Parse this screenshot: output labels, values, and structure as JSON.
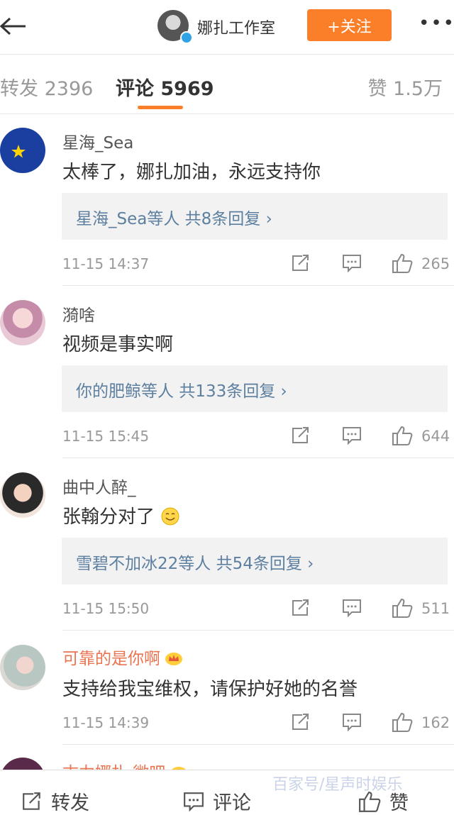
{
  "header": {
    "title": "娜扎工作室",
    "follow_label": "+关注",
    "more": "•••"
  },
  "tabs": {
    "repost": "转发 2396",
    "comment": "评论 5969",
    "like": "赞 1.5万"
  },
  "comments": [
    {
      "name": "星海_Sea",
      "text": "太棒了，娜扎加油，永远支持你",
      "reply": "星海_Sea等人  共8条回复 ›",
      "time": "11-15 14:37",
      "likes": "265"
    },
    {
      "name": "漪啥",
      "text": "视频是事实啊",
      "reply": "你的肥鲸等人  共133条回复 ›",
      "time": "11-15 15:45",
      "likes": "644"
    },
    {
      "name": "曲中人醉_",
      "text": "张翰分对了",
      "reply": "雪碧不加冰22等人  共54条回复 ›",
      "time": "11-15 15:50",
      "likes": "511"
    },
    {
      "name": "可靠的是你啊",
      "text": "支持给我宝维权，请保护好她的名誉",
      "time": "11-15 14:39",
      "likes": "162"
    },
    {
      "name": "古力娜扎 微吧"
    }
  ],
  "bottom": {
    "repost": "转发",
    "comment": "评论",
    "like": "赞"
  },
  "watermark": "百家号/星声时娱乐",
  "colors": {
    "accent": "#fb7e29",
    "link": "#5d7fa0",
    "vip_name": "#eb7350"
  }
}
